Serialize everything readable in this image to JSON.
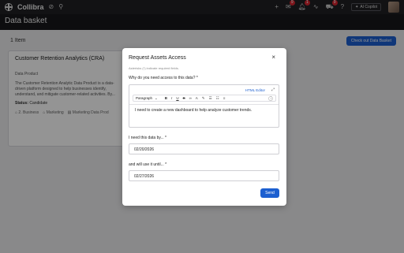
{
  "topbar": {
    "brand": "Collibra",
    "badges": {
      "notify_a": "9",
      "notify_b": "1",
      "notify_c": "9"
    },
    "ai_copilot": "AI Copilot"
  },
  "page": {
    "title": "Data basket"
  },
  "basket": {
    "count_label": "1 Item",
    "checkout_label": "Check out Data Basket",
    "card": {
      "title": "Customer Retention Analytics (CRA)",
      "type": "Data Product",
      "description_line1": "The Customer Retention Analytic Data Product is a data-",
      "description_line2": "driven platform designed to help businesses identify,",
      "description_line3": "understand, and mitigate customer-related activities. By...",
      "status_label": "Status:",
      "status_value": "Candidate",
      "tags": [
        "2. Business",
        "Marketing",
        "Marketing Data Prod"
      ]
    }
  },
  "modal": {
    "title": "Request Assets Access",
    "close": "×",
    "hint": "Asterisks (*) indicate required fields.",
    "q_access": "Why do you need access to this data? *",
    "html_editor": "HTML Editor",
    "paragraph": "Paragraph",
    "editor_text": "I need to create a new dashboard to help analyze customer trends.",
    "q_need_by": "I need this data by... *",
    "need_by_value": "02/20/2026",
    "q_use_until": "and will use it until... *",
    "use_until_value": "02/27/2026",
    "send": "Send"
  }
}
